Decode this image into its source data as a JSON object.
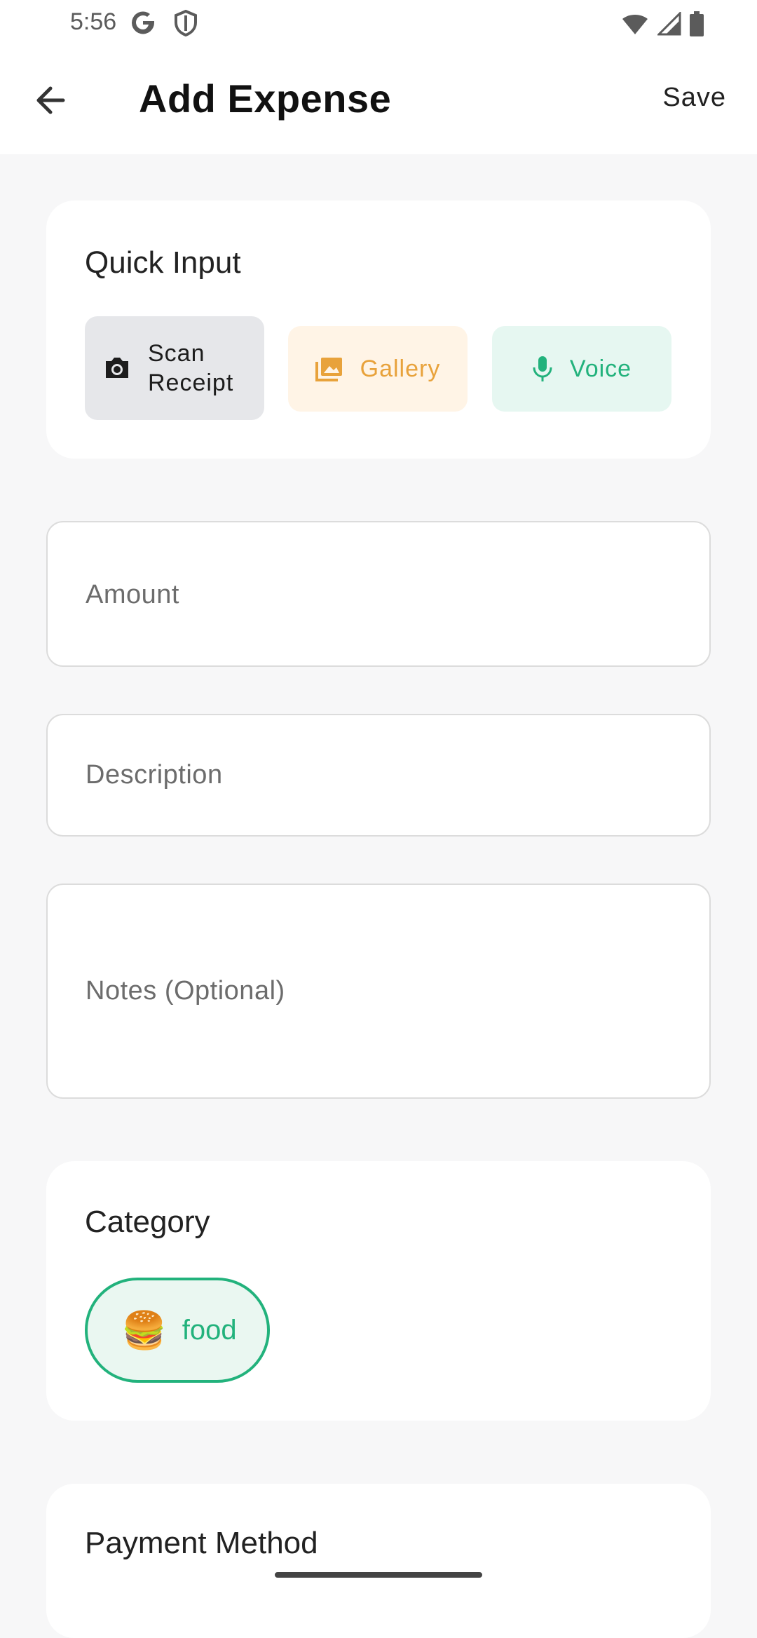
{
  "status": {
    "time": "5:56",
    "icons": [
      "google-icon",
      "shield-icon",
      "wifi-icon",
      "signal-icon",
      "battery-icon"
    ]
  },
  "appbar": {
    "title": "Add Expense",
    "save_label": "Save",
    "back_icon": "arrow-back-icon"
  },
  "quick_input": {
    "title": "Quick Input",
    "buttons": [
      {
        "label": "Scan Receipt",
        "icon": "camera-icon"
      },
      {
        "label": "Gallery",
        "icon": "image-icon"
      },
      {
        "label": "Voice",
        "icon": "mic-icon"
      }
    ]
  },
  "fields": {
    "amount_placeholder": "Amount",
    "description_placeholder": "Description",
    "notes_placeholder": "Notes (Optional)"
  },
  "category": {
    "title": "Category",
    "selected": {
      "emoji": "🍔",
      "label": "food"
    }
  },
  "payment": {
    "title": "Payment Method"
  },
  "colors": {
    "accent_green": "#22b27c",
    "accent_orange": "#e8a23b",
    "background": "#f7f7f8"
  }
}
